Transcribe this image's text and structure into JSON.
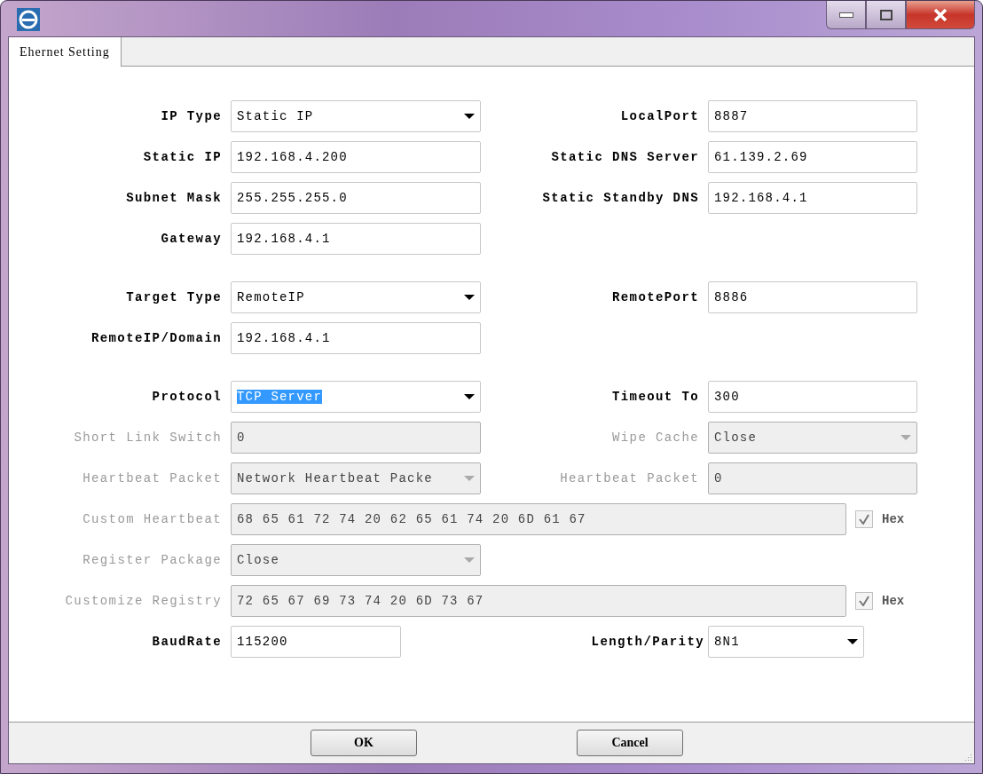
{
  "tabs": [
    {
      "label": "Ehernet Setting",
      "selected": true
    }
  ],
  "groups": [
    [
      {
        "kind": "pair",
        "left": {
          "label": "IP Type",
          "disabled": false,
          "field": {
            "kind": "dropdown",
            "value": "Static IP"
          }
        },
        "right": {
          "label": "LocalPort",
          "disabled": false,
          "field": {
            "kind": "text",
            "value": "8887"
          }
        }
      },
      {
        "kind": "pair",
        "left": {
          "label": "Static IP",
          "disabled": false,
          "field": {
            "kind": "text",
            "value": "192.168.4.200"
          }
        },
        "right": {
          "label": "Static DNS Server",
          "disabled": false,
          "field": {
            "kind": "text",
            "value": "61.139.2.69"
          }
        }
      },
      {
        "kind": "pair",
        "left": {
          "label": "Subnet Mask",
          "disabled": false,
          "field": {
            "kind": "text",
            "value": "255.255.255.0"
          }
        },
        "right": {
          "label": "Static Standby DNS",
          "disabled": false,
          "field": {
            "kind": "text",
            "value": "192.168.4.1"
          }
        }
      },
      {
        "kind": "pair",
        "left": {
          "label": "Gateway",
          "disabled": false,
          "field": {
            "kind": "text",
            "value": "192.168.4.1"
          }
        }
      }
    ],
    [
      {
        "kind": "pair",
        "left": {
          "label": "Target Type",
          "disabled": false,
          "field": {
            "kind": "dropdown",
            "value": "RemoteIP"
          }
        },
        "right": {
          "label": "RemotePort",
          "disabled": false,
          "field": {
            "kind": "text",
            "value": "8886"
          }
        }
      },
      {
        "kind": "pair",
        "left": {
          "label": "RemoteIP/Domain",
          "disabled": false,
          "field": {
            "kind": "text",
            "value": "192.168.4.1"
          }
        }
      }
    ],
    [
      {
        "kind": "pair",
        "left": {
          "label": "Protocol",
          "disabled": false,
          "field": {
            "kind": "dropdown",
            "value": "TCP Server",
            "text_selected": true
          }
        },
        "right": {
          "label": "Timeout To",
          "disabled": false,
          "field": {
            "kind": "text",
            "value": "300"
          }
        }
      },
      {
        "kind": "pair",
        "left": {
          "label": "Short Link Switch",
          "disabled": true,
          "field": {
            "kind": "text",
            "value": "0"
          }
        },
        "right": {
          "label": "Wipe Cache",
          "disabled": true,
          "field": {
            "kind": "dropdown",
            "value": "Close"
          }
        }
      },
      {
        "kind": "pair",
        "left": {
          "label": "Heartbeat Packet",
          "disabled": true,
          "field": {
            "kind": "dropdown",
            "value": "Network Heartbeat Packe"
          }
        },
        "right": {
          "label": "Heartbeat Packet",
          "disabled": true,
          "field": {
            "kind": "text",
            "value": "0"
          }
        }
      },
      {
        "kind": "wide",
        "label": "Custom Heartbeat",
        "disabled": true,
        "field": {
          "kind": "text",
          "value": "68 65 61 72 74 20 62 65 61 74 20 6D 61 67"
        },
        "checkbox": {
          "label": "Hex",
          "checked": true,
          "disabled": true
        }
      },
      {
        "kind": "pair",
        "left": {
          "label": "Register Package",
          "disabled": true,
          "field": {
            "kind": "dropdown",
            "value": "Close"
          }
        }
      },
      {
        "kind": "wide",
        "label": "Customize Registry",
        "disabled": true,
        "field": {
          "kind": "text",
          "value": "72 65 67 69 73 74 20 6D 73 67"
        },
        "checkbox": {
          "label": "Hex",
          "checked": true,
          "disabled": true
        }
      },
      {
        "kind": "baud",
        "left": {
          "label": "BaudRate",
          "disabled": false,
          "field": {
            "kind": "text",
            "value": "115200"
          }
        },
        "right": {
          "label": "Length/Parity",
          "disabled": false,
          "field": {
            "kind": "dropdown",
            "value": "8N1"
          }
        }
      }
    ]
  ],
  "buttons": [
    "OK",
    "Cancel"
  ]
}
